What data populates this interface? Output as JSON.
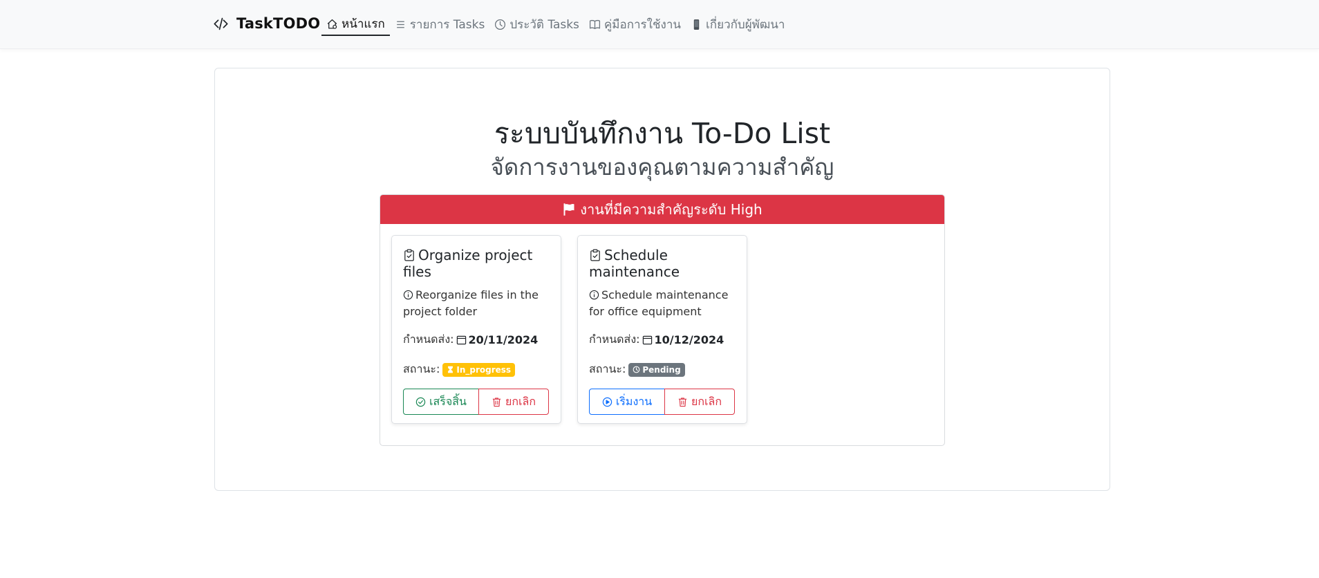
{
  "navbar": {
    "brand": "TaskTODO",
    "links": [
      {
        "label": "หน้าแรก",
        "icon": "home-icon",
        "active": true
      },
      {
        "label": "รายการ Tasks",
        "icon": "list-icon",
        "active": false
      },
      {
        "label": "ประวัติ Tasks",
        "icon": "clock-icon",
        "active": false
      },
      {
        "label": "คู่มือการใช้งาน",
        "icon": "book-icon",
        "active": false
      },
      {
        "label": "เกี่ยวกับผู้พัฒนา",
        "icon": "phone-icon",
        "active": false
      }
    ]
  },
  "main": {
    "title": "ระบบบันทึกงาน To-Do List",
    "subtitle": "จัดการงานของคุณตามความสำคัญ"
  },
  "priority_panel": {
    "header": "งานที่มีความสำคัญระดับ High",
    "header_icon": "flag-icon",
    "header_color": "#dc3545"
  },
  "tasks": [
    {
      "title": "Organize project files",
      "description": "Reorganize files in the project folder",
      "due_label": "กำหนดส่ง:",
      "due_date": "20/11/2024",
      "status_label": "สถานะ:",
      "status": "In_progress",
      "status_color": "#ffc107",
      "primary_action": "เสร็จสิ้น",
      "secondary_action": "ยกเลิก"
    },
    {
      "title": "Schedule maintenance",
      "description": "Schedule maintenance for office equipment",
      "due_label": "กำหนดส่ง:",
      "due_date": "10/12/2024",
      "status_label": "สถานะ:",
      "status": "Pending",
      "status_color": "#6c757d",
      "primary_action": "เริ่มงาน",
      "secondary_action": "ยกเลิก"
    }
  ]
}
